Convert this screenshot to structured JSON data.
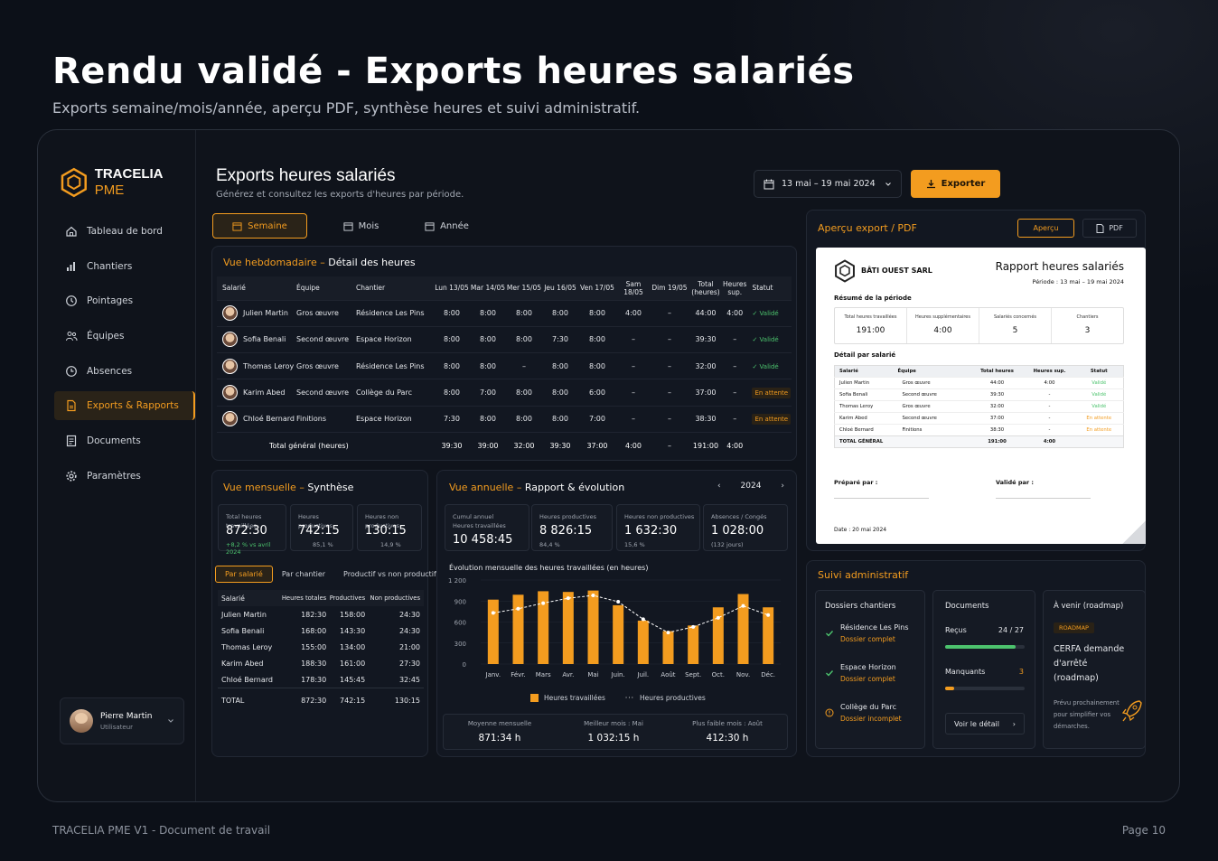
{
  "doc": {
    "title": "Rendu validé - Exports heures salariés",
    "subtitle": "Exports semaine/mois/année, aperçu PDF, synthèse heures et suivi administratif.",
    "footer_left": "TRACELIA PME V1 - Document de travail",
    "footer_right": "Page 10"
  },
  "brand": {
    "name": "TRACELIA",
    "suffix": " PME",
    "accent": "#f39c1f"
  },
  "sidebar": {
    "items": [
      {
        "label": "Tableau de bord",
        "icon": "home-icon"
      },
      {
        "label": "Chantiers",
        "icon": "chart-icon"
      },
      {
        "label": "Pointages",
        "icon": "clock-icon"
      },
      {
        "label": "Équipes",
        "icon": "users-icon"
      },
      {
        "label": "Absences",
        "icon": "absence-clock-icon"
      },
      {
        "label": "Exports & Rapports",
        "icon": "export-file-icon",
        "active": true
      },
      {
        "label": "Documents",
        "icon": "document-icon"
      },
      {
        "label": "Paramètres",
        "icon": "gear-icon"
      }
    ],
    "user": {
      "name": "Pierre Martin",
      "role": "Utilisateur"
    }
  },
  "header": {
    "title": "Exports heures salariés",
    "subtitle": "Générez et consultez les exports d'heures par période.",
    "date_range": "13 mai – 19 mai 2024",
    "export_label": "Exporter"
  },
  "tabs": [
    "Semaine",
    "Mois",
    "Année"
  ],
  "weekly": {
    "title_accent": "Vue hebdomadaire –",
    "title": " Détail des heures",
    "columns": [
      "Salarié",
      "Équipe",
      "Chantier",
      "Lun 13/05",
      "Mar 14/05",
      "Mer 15/05",
      "Jeu 16/05",
      "Ven 17/05",
      "Sam 18/05",
      "Dim 19/05",
      "Total (heures)",
      "Heures sup.",
      "Statut"
    ],
    "rows": [
      {
        "name": "Julien Martin",
        "team": "Gros œuvre",
        "site": "Résidence Les Pins",
        "days": [
          "8:00",
          "8:00",
          "8:00",
          "8:00",
          "8:00",
          "4:00",
          "–"
        ],
        "total": "44:00",
        "sup": "4:00",
        "status": "Validé",
        "ok": true
      },
      {
        "name": "Sofia Benali",
        "team": "Second œuvre",
        "site": "Espace Horizon",
        "days": [
          "8:00",
          "8:00",
          "8:00",
          "7:30",
          "8:00",
          "–",
          "–"
        ],
        "total": "39:30",
        "sup": "–",
        "status": "Validé",
        "ok": true
      },
      {
        "name": "Thomas Leroy",
        "team": "Gros œuvre",
        "site": "Résidence Les Pins",
        "days": [
          "8:00",
          "8:00",
          "–",
          "8:00",
          "8:00",
          "–",
          "–"
        ],
        "total": "32:00",
        "sup": "–",
        "status": "Validé",
        "ok": true
      },
      {
        "name": "Karim Abed",
        "team": "Second œuvre",
        "site": "Collège du Parc",
        "days": [
          "8:00",
          "7:00",
          "8:00",
          "8:00",
          "6:00",
          "–",
          "–"
        ],
        "total": "37:00",
        "sup": "–",
        "status": "En attente",
        "ok": false
      },
      {
        "name": "Chloé Bernard",
        "team": "Finitions",
        "site": "Espace Horizon",
        "days": [
          "7:30",
          "8:00",
          "8:00",
          "8:00",
          "7:00",
          "–",
          "–"
        ],
        "total": "38:30",
        "sup": "–",
        "status": "En attente",
        "ok": false
      }
    ],
    "total_label": "Total général (heures)",
    "totals": [
      "39:30",
      "39:00",
      "32:00",
      "39:30",
      "37:00",
      "4:00",
      "–",
      "191:00",
      "4:00"
    ]
  },
  "monthly": {
    "title_accent": "Vue mensuelle –",
    "title": " Synthèse",
    "kpis": [
      {
        "label": "Total heures travaillées",
        "value": "872:30",
        "sub": "+8,2 % vs avril 2024"
      },
      {
        "label": "Heures productives",
        "value": "742:15",
        "sub": "85,1 %"
      },
      {
        "label": "Heures non productives",
        "value": "130:15",
        "sub": "14,9 %"
      }
    ],
    "subtabs": [
      "Par salarié",
      "Par chantier",
      "Productif vs non productif"
    ],
    "columns": [
      "Salarié",
      "Heures totales",
      "Productives",
      "Non productives"
    ],
    "rows": [
      [
        "Julien Martin",
        "182:30",
        "158:00",
        "24:30"
      ],
      [
        "Sofia Benali",
        "168:00",
        "143:30",
        "24:30"
      ],
      [
        "Thomas Leroy",
        "155:00",
        "134:00",
        "21:00"
      ],
      [
        "Karim Abed",
        "188:30",
        "161:00",
        "27:30"
      ],
      [
        "Chloé Bernard",
        "178:30",
        "145:45",
        "32:45"
      ]
    ],
    "total": [
      "TOTAL",
      "872:30",
      "742:15",
      "130:15"
    ]
  },
  "annual": {
    "title_accent": "Vue annuelle –",
    "title": " Rapport & évolution",
    "year": "2024",
    "kpis": [
      {
        "label": "Cumul annuel Heures travaillées",
        "value": "10 458:45",
        "sub": ""
      },
      {
        "label": "Heures productives",
        "value": "8 826:15",
        "sub": "84,4 %"
      },
      {
        "label": "Heures non productives",
        "value": "1 632:30",
        "sub": "15,6 %"
      },
      {
        "label": "Absences / Congés",
        "value": "1 028:00",
        "sub": "(132 jours)"
      }
    ],
    "chart_title": "Évolution mensuelle des heures travaillées (en heures)",
    "stats": [
      {
        "label": "Moyenne mensuelle",
        "value": "871:34 h"
      },
      {
        "label": "Meilleur mois : Mai",
        "value": "1 032:15 h"
      },
      {
        "label": "Plus faible mois : Août",
        "value": "412:30 h"
      }
    ]
  },
  "chart_data": {
    "type": "bar",
    "title": "Évolution mensuelle des heures travaillées (en heures)",
    "categories": [
      "Janv.",
      "Févr.",
      "Mars",
      "Avr.",
      "Mai",
      "Juin.",
      "Juil.",
      "Août",
      "Sept.",
      "Oct.",
      "Nov.",
      "Déc."
    ],
    "yticks": [
      "0",
      "300",
      "600",
      "900",
      "1 200"
    ],
    "ylim": [
      0,
      1200
    ],
    "series": [
      {
        "name": "Heures travaillées",
        "type": "bar",
        "color": "#f39c1f",
        "values": [
          920,
          990,
          1040,
          1030,
          1050,
          840,
          620,
          470,
          550,
          810,
          1000,
          810
        ]
      },
      {
        "name": "Heures productives",
        "type": "line",
        "color": "#ffffff",
        "values": [
          730,
          790,
          870,
          940,
          980,
          890,
          640,
          450,
          530,
          660,
          830,
          700
        ]
      }
    ]
  },
  "preview": {
    "title": "Aperçu export / PDF",
    "btn_preview": "Aperçu",
    "btn_pdf": "PDF",
    "company": "BÂTI OUEST SARL",
    "report_title": "Rapport heures salariés",
    "period": "Période : 13 mai – 19 mai 2024",
    "summary_title": "Résumé de la période",
    "summary": [
      {
        "label": "Total heures travaillées",
        "value": "191:00"
      },
      {
        "label": "Heures supplémentaires",
        "value": "4:00"
      },
      {
        "label": "Salariés concernés",
        "value": "5"
      },
      {
        "label": "Chantiers",
        "value": "3"
      }
    ],
    "detail_title": "Détail par salarié",
    "columns": [
      "Salarié",
      "Équipe",
      "Total heures",
      "Heures sup.",
      "Statut"
    ],
    "rows": [
      [
        "Julien Martin",
        "Gros œuvre",
        "44:00",
        "4:00",
        "Validé"
      ],
      [
        "Sofia Benali",
        "Second œuvre",
        "39:30",
        "-",
        "Validé"
      ],
      [
        "Thomas Leroy",
        "Gros œuvre",
        "32:00",
        "-",
        "Validé"
      ],
      [
        "Karim Abed",
        "Second œuvre",
        "37:00",
        "-",
        "En attente"
      ],
      [
        "Chloé Bernard",
        "Finitions",
        "38:30",
        "-",
        "En attente"
      ]
    ],
    "total": [
      "TOTAL GÉNÉRAL",
      "",
      "191:00",
      "4:00",
      ""
    ],
    "prepared": "Préparé par :",
    "validated": "Validé par :",
    "date": "Date : 20 mai 2024"
  },
  "admin": {
    "title": "Suivi administratif",
    "dossiers_title": "Dossiers chantiers",
    "dossiers": [
      {
        "name": "Résidence Les Pins",
        "status": "Dossier complet",
        "ok": true
      },
      {
        "name": "Espace Horizon",
        "status": "Dossier complet",
        "ok": true
      },
      {
        "name": "Collège du Parc",
        "status": "Dossier incomplet",
        "ok": false
      }
    ],
    "documents_title": "Documents",
    "received_label": "Reçus",
    "received_value": "24 / 27",
    "received_fraction": 0.89,
    "missing_label": "Manquants",
    "missing_value": "3",
    "missing_fraction": 0.11,
    "detail_btn": "Voir le détail",
    "roadmap_title": "À venir (roadmap)",
    "roadmap_badge": "ROADMAP",
    "roadmap_item": "CERFA demande d'arrêté (roadmap)",
    "roadmap_note": "Prévu prochainement pour simplifier vos démarches."
  }
}
